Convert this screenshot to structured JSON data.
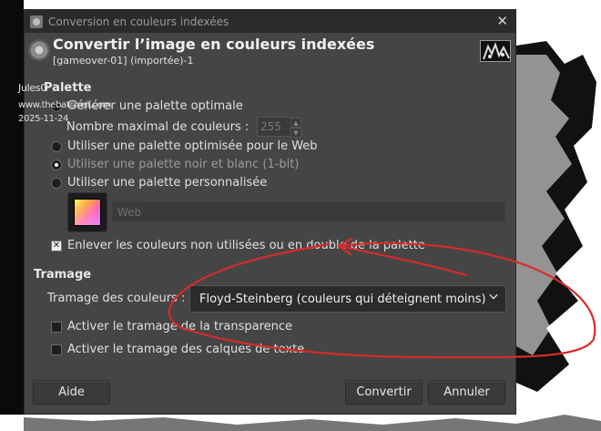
{
  "window": {
    "title": "Conversion en couleurs indexées",
    "close_glyph": "✕"
  },
  "header": {
    "title": "Convertir l’image en couleurs indexées",
    "subtitle": "[gameover-01] (importée)-1"
  },
  "overlay": {
    "line1": "JulesO",
    "line2": "www.thebatcheif.com",
    "line3": "2025-11-24"
  },
  "palette": {
    "section_title": "Palette",
    "option_optimal": "Générer une palette optimale",
    "max_colors_label": "Nombre maximal de couleurs :",
    "max_colors_value": "255",
    "option_web": "Utiliser une palette optimisée pour le Web",
    "option_bw": "Utiliser une palette noir et blanc (1-bit)",
    "option_custom": "Utiliser une palette personnalisée",
    "custom_palette_name": "Web",
    "remove_unused": "Enlever les couleurs non utilisées ou en double de la palette"
  },
  "dithering": {
    "section_title": "Tramage",
    "color_dither_label": "Tramage des couleurs :",
    "color_dither_value": "Floyd-Steinberg (couleurs qui déteignent moins)",
    "transparency_dither": "Activer le tramage de la transparence",
    "text_layers_dither": "Activer le tramage des calques de texte"
  },
  "buttons": {
    "help": "Aide",
    "convert": "Convertir",
    "cancel": "Annuler"
  },
  "colors": {
    "dialog_bg": "#454545",
    "annotation": "#d62b2b"
  }
}
